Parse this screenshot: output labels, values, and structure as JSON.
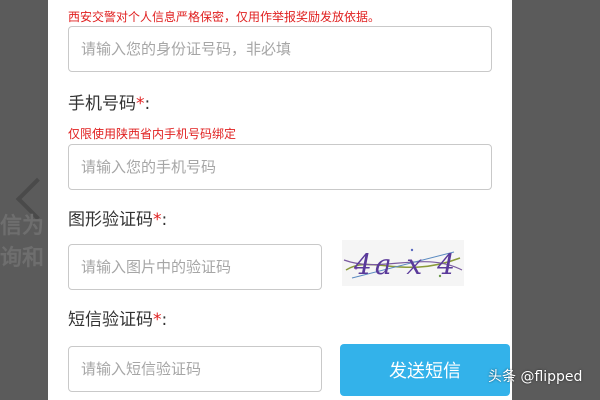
{
  "background": {
    "partial_text_line1": "信为",
    "partial_text_line2": "询和"
  },
  "form": {
    "privacy_note": "西安交警对个人信息严格保密，仅用作举报奖励发放依据。",
    "id_input": {
      "placeholder": "请输入您的身份证号码，非必填"
    },
    "phone": {
      "label": "手机号码",
      "required_mark": "*",
      "colon": ":",
      "note": "仅限使用陕西省内手机号码绑定",
      "placeholder": "请输入您的手机号码"
    },
    "captcha": {
      "label": "图形验证码",
      "required_mark": "*",
      "colon": ":",
      "placeholder": "请输入图片中的验证码",
      "image_text": "4a x 4"
    },
    "sms": {
      "label": "短信验证码",
      "required_mark": "*",
      "colon": ":",
      "placeholder": "请输入短信验证码",
      "send_button": "发送短信"
    }
  },
  "watermark": "头条 @flipped",
  "colors": {
    "accent": "#33b2ea",
    "required": "#e02020",
    "overlay": "#5b5b5b"
  }
}
